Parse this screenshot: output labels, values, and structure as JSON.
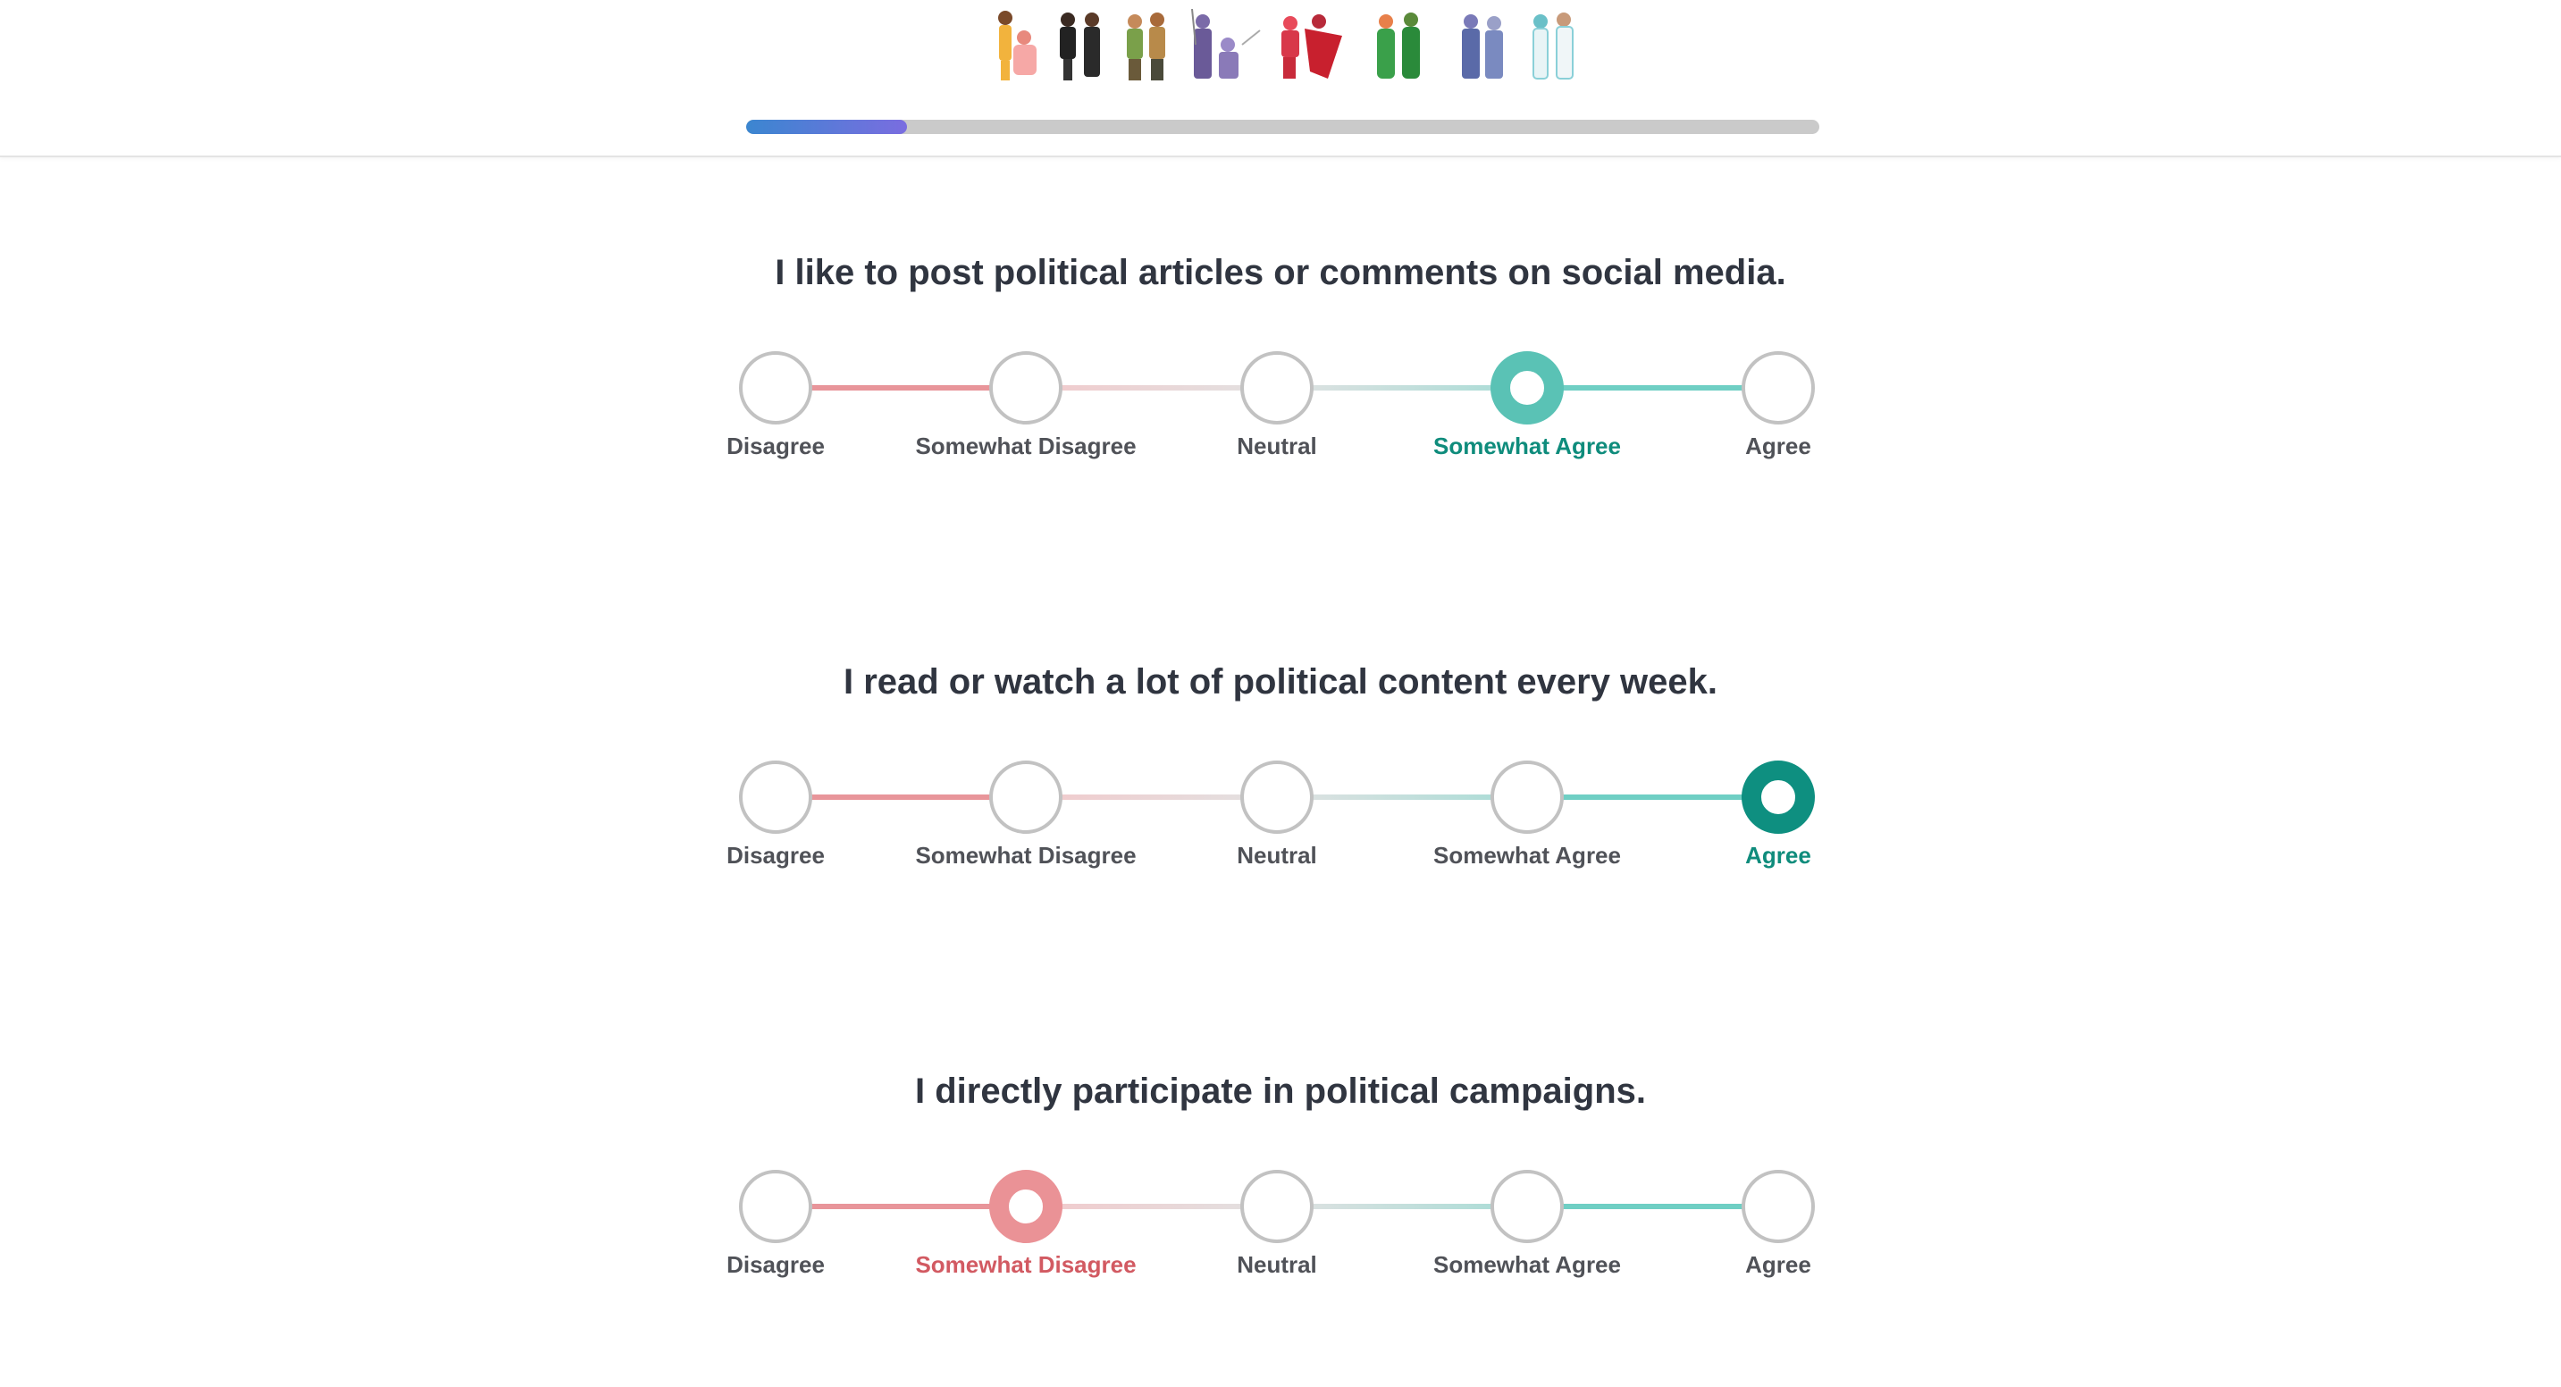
{
  "header": {
    "characters_icon": "group-of-character-figures",
    "progress_fraction": 0.15
  },
  "colors": {
    "disagree_strong": "#e8959a",
    "disagree_soft": "#f2c9cb",
    "neutral": "#e2e2e2",
    "agree_soft": "#a7dcd6",
    "agree_strong": "#6fcfc4",
    "selected_agree_somewhat": "#5ac2b5",
    "selected_agree": "#0e8f80",
    "selected_disagree_somewhat": "#ea9296",
    "label_agree": "#0f8c7c",
    "label_disagree": "#d25a62"
  },
  "scale_options": [
    "Disagree",
    "Somewhat Disagree",
    "Neutral",
    "Somewhat Agree",
    "Agree"
  ],
  "questions": [
    {
      "text": "I like to post political articles or comments on social media.",
      "selected": 3
    },
    {
      "text": "I read or watch a lot of political content every week.",
      "selected": 4
    },
    {
      "text": "I directly participate in political campaigns.",
      "selected": 1
    }
  ]
}
